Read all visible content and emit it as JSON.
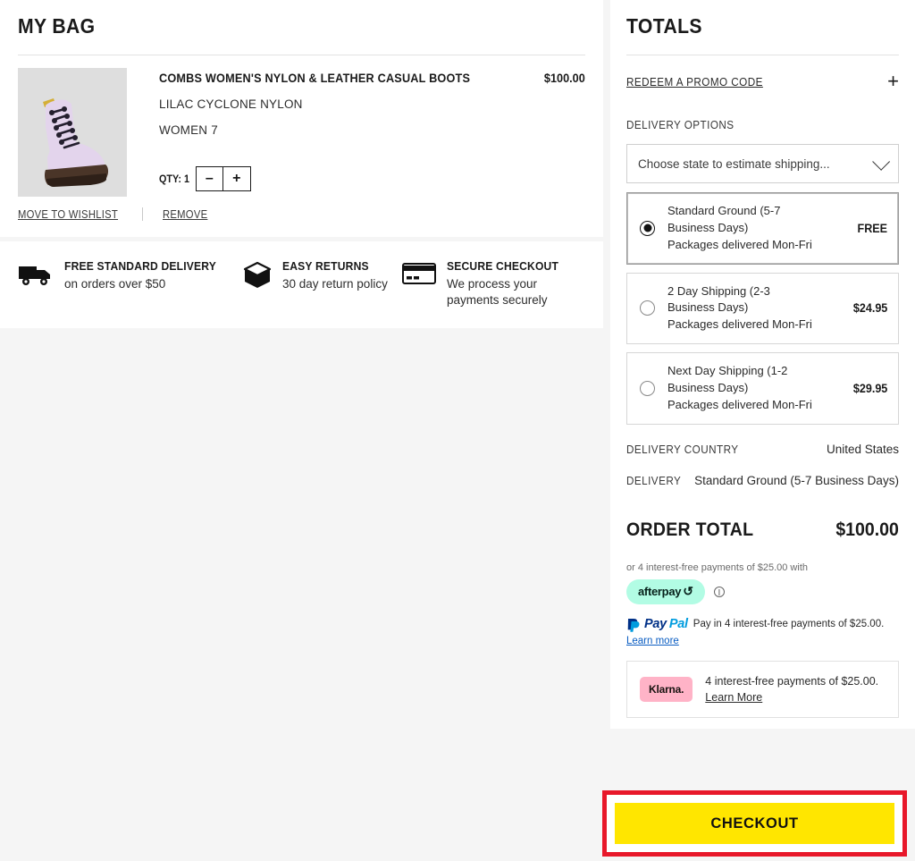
{
  "bag": {
    "title": "MY BAG",
    "item": {
      "name": "COMBS WOMEN'S NYLON & LEATHER CASUAL BOOTS",
      "price": "$100.00",
      "colorway": "LILAC CYCLONE NYLON",
      "size": "WOMEN 7",
      "qty_label": "QTY: 1",
      "qty_value": 1,
      "decrease_label": "–",
      "increase_label": "+",
      "thumb_bg": "#dedede",
      "boot_color": "#e3d4ec"
    },
    "actions": {
      "move_to_wishlist": "MOVE TO WISHLIST",
      "remove": "REMOVE"
    }
  },
  "benefits": [
    {
      "icon": "truck-icon",
      "heading": "FREE STANDARD DELIVERY",
      "sub": "on orders over $50"
    },
    {
      "icon": "box-icon",
      "heading": "EASY RETURNS",
      "sub": "30 day return policy"
    },
    {
      "icon": "credit-card-icon",
      "heading": "SECURE CHECKOUT",
      "sub": "We process your payments securely"
    }
  ],
  "totals": {
    "title": "TOTALS",
    "promo": {
      "label": "REDEEM A PROMO CODE",
      "expand_icon": "plus-icon"
    },
    "delivery_options_label": "DELIVERY OPTIONS",
    "state_select": {
      "value": "Choose state to estimate shipping...",
      "chevron": "chevron-down-icon"
    },
    "shipping_options": [
      {
        "name": "Standard Ground (5-7 Business Days)",
        "line1": "Standard Ground (5-7",
        "line2": "Business Days)",
        "note": "Packages delivered Mon-Fri",
        "price": "FREE",
        "selected": true
      },
      {
        "name": "2 Day Shipping (2-3 Business Days)",
        "line1": "2 Day Shipping (2-3",
        "line2": "Business Days)",
        "note": "Packages delivered Mon-Fri",
        "price": "$24.95",
        "selected": false
      },
      {
        "name": "Next Day Shipping (1-2 Business Days)",
        "line1": "Next Day Shipping (1-2",
        "line2": "Business Days)",
        "note": "Packages delivered Mon-Fri",
        "price": "$29.95",
        "selected": false
      }
    ],
    "delivery_country_label": "DELIVERY COUNTRY",
    "delivery_country_value": "United States",
    "delivery_label": "DELIVERY",
    "delivery_value": "Standard Ground (5-7 Business Days)",
    "order_total_label": "ORDER TOTAL",
    "order_total_value": "$100.00"
  },
  "payments": {
    "afterpay": {
      "note": "or 4 interest-free payments of $25.00 with",
      "badge_text": "afterpay",
      "badge_mark": "⟳",
      "badge_color": "#b2fce4",
      "info_icon": "info-icon"
    },
    "paypal": {
      "brand_pay": "Pay",
      "brand_pal": "Pal",
      "text": "Pay in 4 interest-free payments of $25.00.",
      "learn_more": "Learn more",
      "color_pay": "#003087",
      "color_pal": "#009cde"
    },
    "klarna": {
      "badge_text": "Klarna.",
      "badge_color": "#ffb3c7",
      "text": "4 interest-free payments of $25.00.",
      "learn_more": "Learn More"
    }
  },
  "checkout": {
    "label": "CHECKOUT",
    "button_color": "#ffe600",
    "highlight_color": "#e8182a"
  }
}
